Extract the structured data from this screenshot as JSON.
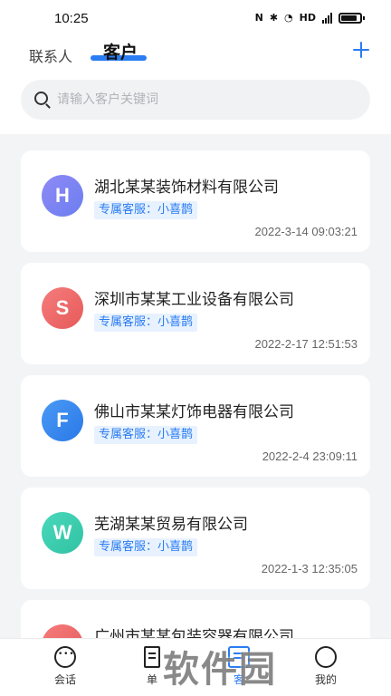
{
  "status_bar": {
    "time": "10:25",
    "icons": [
      "nfc-icon",
      "bluetooth-icon",
      "wifi-icon",
      "hd-icon",
      "5g-signal-icon",
      "battery-icon"
    ]
  },
  "header": {
    "tabs": [
      {
        "label": "联系人",
        "active": false
      },
      {
        "label": "客户",
        "active": true
      }
    ],
    "add_icon": "plus-icon",
    "accent_color": "#2a7cf2"
  },
  "search": {
    "placeholder": "请输入客户关键词",
    "value": ""
  },
  "customers": [
    {
      "initial": "H",
      "name": "湖北某某装饰材料有限公司",
      "agent": "专属客服：小喜鹊",
      "time": "2022-3-14  09:03:21",
      "color": "#7b7ff0"
    },
    {
      "initial": "S",
      "name": "深圳市某某工业设备有限公司",
      "agent": "专属客服：小喜鹊",
      "time": "2022-2-17  12:51:53",
      "color": "#ee6b6b"
    },
    {
      "initial": "F",
      "name": "佛山市某某灯饰电器有限公司",
      "agent": "专属客服：小喜鹊",
      "time": "2022-2-4    23:09:11",
      "color": "#3a8cf0"
    },
    {
      "initial": "W",
      "name": "芜湖某某贸易有限公司",
      "agent": "专属客服：小喜鹊",
      "time": "2022-1-3  12:35:05",
      "color": "#3fcfb0"
    },
    {
      "initial": "",
      "name": "广州市某某包装容器有限公司",
      "agent": "",
      "time": "",
      "color": "#ee6b6b"
    }
  ],
  "bottom_nav": [
    {
      "label": "会话",
      "icon": "chat-icon"
    },
    {
      "label": "单",
      "icon": "order-icon"
    },
    {
      "label": "客",
      "icon": "customer-icon"
    },
    {
      "label": "我的",
      "icon": "me-icon"
    }
  ],
  "watermark": "软件园"
}
